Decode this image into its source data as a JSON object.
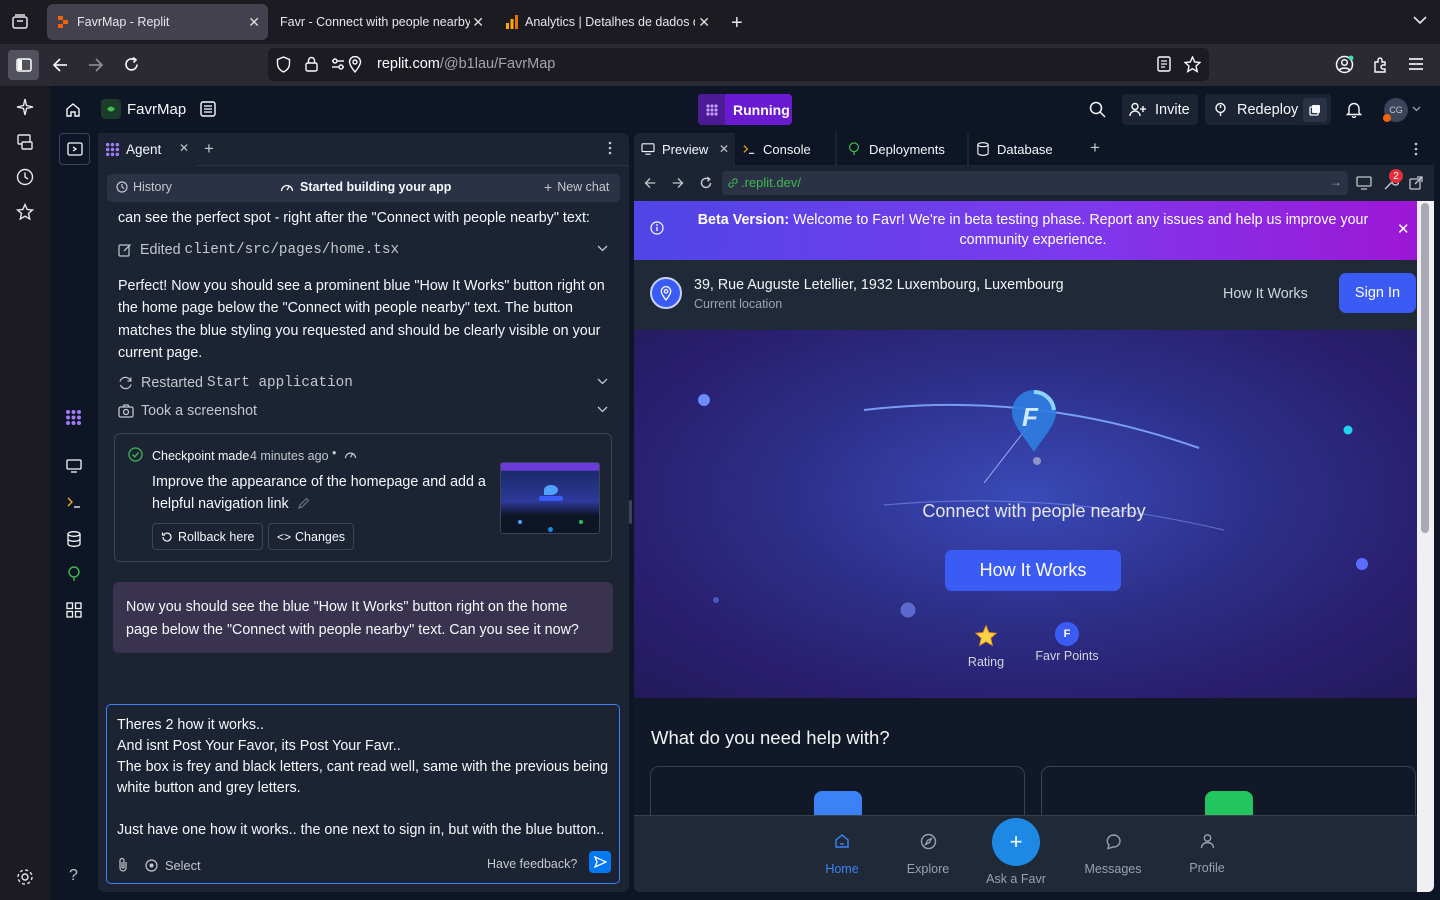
{
  "browser": {
    "tabs": [
      {
        "title": "FavrMap - Replit",
        "active": true
      },
      {
        "title": "Favr - Connect with people nearby y",
        "active": false
      },
      {
        "title": "Analytics | Detalhes de dados d",
        "active": false
      }
    ],
    "url_domain": "replit.com",
    "url_path": "/@b1lau/FavrMap"
  },
  "replit": {
    "repl_name": "FavrMap",
    "run_status": "Running",
    "invite_label": "Invite",
    "redeploy_label": "Redeploy",
    "avatar_initials": "CG"
  },
  "agent": {
    "tab_label": "Agent",
    "history_label": "History",
    "status_label": "Started building your app",
    "new_chat_label": "New chat",
    "intro_text": "can see the perfect spot - right after the \"Connect with people nearby\" text:",
    "edited_action": "Edited",
    "edited_file": "client/src/pages/home.tsx",
    "message": "Perfect! Now you should see a prominent blue \"How It Works\" button right on the home page below the \"Connect with people nearby\" text. The button matches the blue styling you requested and should be clearly visible on your current page.",
    "restarted_action": "Restarted",
    "restarted_name": "Start application",
    "screenshot_action": "Took a screenshot",
    "checkpoint_label": "Checkpoint made",
    "checkpoint_time": "4 minutes ago",
    "checkpoint_desc": "Improve the appearance of the homepage and add a helpful navigation link",
    "rollback_label": "Rollback here",
    "changes_label": "Changes",
    "bot_question": "Now you should see the blue \"How It Works\" button right on the home page below the \"Connect with people nearby\" text. Can you see it now?",
    "input_lines": [
      "Theres 2 how it works..",
      "And isnt Post Your Favor, its Post Your Favr..",
      "The box is frey and black letters, cant read well, same with the previous being white button and grey letters.",
      "",
      "Just have one how it works.. the one next to sign in, but with the blue button.."
    ],
    "select_label": "Select",
    "feedback_label": "Have feedback?"
  },
  "preview": {
    "tabs": [
      "Preview",
      "Console",
      "Deployments",
      "Database"
    ],
    "url": ".replit.dev/",
    "notification_count": "2",
    "app": {
      "beta_label": "Beta Version:",
      "beta_text": "Welcome to Favr! We're in beta testing phase. Report any issues and help us improve your community experience.",
      "location_address": "39, Rue Auguste Letellier, 1932 Luxembourg, Luxembourg",
      "location_sub": "Current location",
      "how_it_works_link": "How It Works",
      "sign_in_label": "Sign In",
      "hero_tagline": "Connect with people nearby",
      "hero_button": "How It Works",
      "rating_label": "Rating",
      "favr_points_label": "Favr Points",
      "favr_points_badge": "F",
      "help_title": "What do you need help with?",
      "bottom_nav": [
        "Home",
        "Explore",
        "Ask a Favr",
        "Messages",
        "Profile"
      ],
      "active_nav": "Home"
    }
  },
  "colors": {
    "replit_bg": "#0e1525",
    "pane_bg": "#1c2333",
    "running": "#6a1bd1",
    "beta_gradient_start": "#4f46e5",
    "beta_gradient_end": "#9d17d6",
    "sign_in": "#3b5bf5",
    "ask_fab": "#1e88e5"
  }
}
